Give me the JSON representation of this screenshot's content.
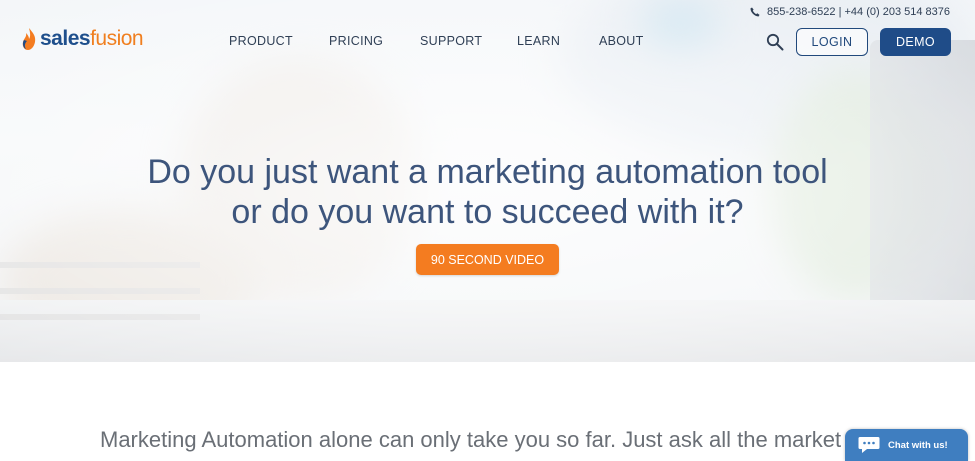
{
  "brand": {
    "name_part1": "sales",
    "name_part2": "fusion",
    "primary_color": "#1f4c88",
    "accent_color": "#f47c20"
  },
  "header": {
    "phone_text": "855-238-6522 | +44 (0) 203 514 8376",
    "nav": [
      "PRODUCT",
      "PRICING",
      "SUPPORT",
      "LEARN",
      "ABOUT"
    ],
    "search_icon": "search-icon",
    "login_label": "LOGIN",
    "demo_label": "DEMO"
  },
  "hero": {
    "headline_line1": "Do you just want a marketing automation tool",
    "headline_line2": "or do you want to succeed with it?",
    "cta_label": "90 SECOND VIDEO"
  },
  "intro": {
    "line1": "Marketing Automation alone can only take you so far. Just ask all the market"
  },
  "chat": {
    "label": "Chat with us!",
    "icon": "chat-bubble-icon",
    "color": "#3f7ec0"
  }
}
